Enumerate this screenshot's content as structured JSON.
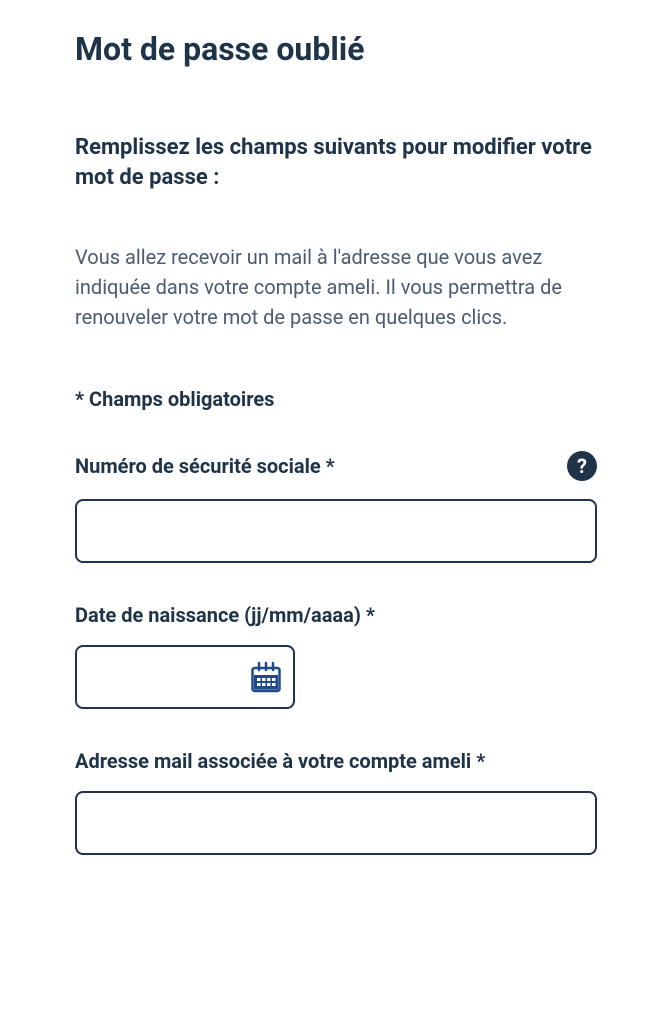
{
  "page": {
    "title": "Mot de passe oublié",
    "subtitle": "Remplissez les champs suivants pour modifier votre mot de passe :",
    "description": "Vous allez recevoir un mail à l'adresse que vous avez indiquée dans votre compte ameli. Il vous permettra de renouveler votre mot de passe en quelques clics.",
    "required_note": "* Champs obligatoires"
  },
  "fields": {
    "ssn": {
      "label": "Numéro de sécurité sociale *",
      "value": ""
    },
    "dob": {
      "label": "Date de naissance (jj/mm/aaaa) *",
      "value": ""
    },
    "email": {
      "label": "Adresse mail associée à votre compte ameli *",
      "value": ""
    }
  },
  "help": {
    "glyph": "?"
  }
}
